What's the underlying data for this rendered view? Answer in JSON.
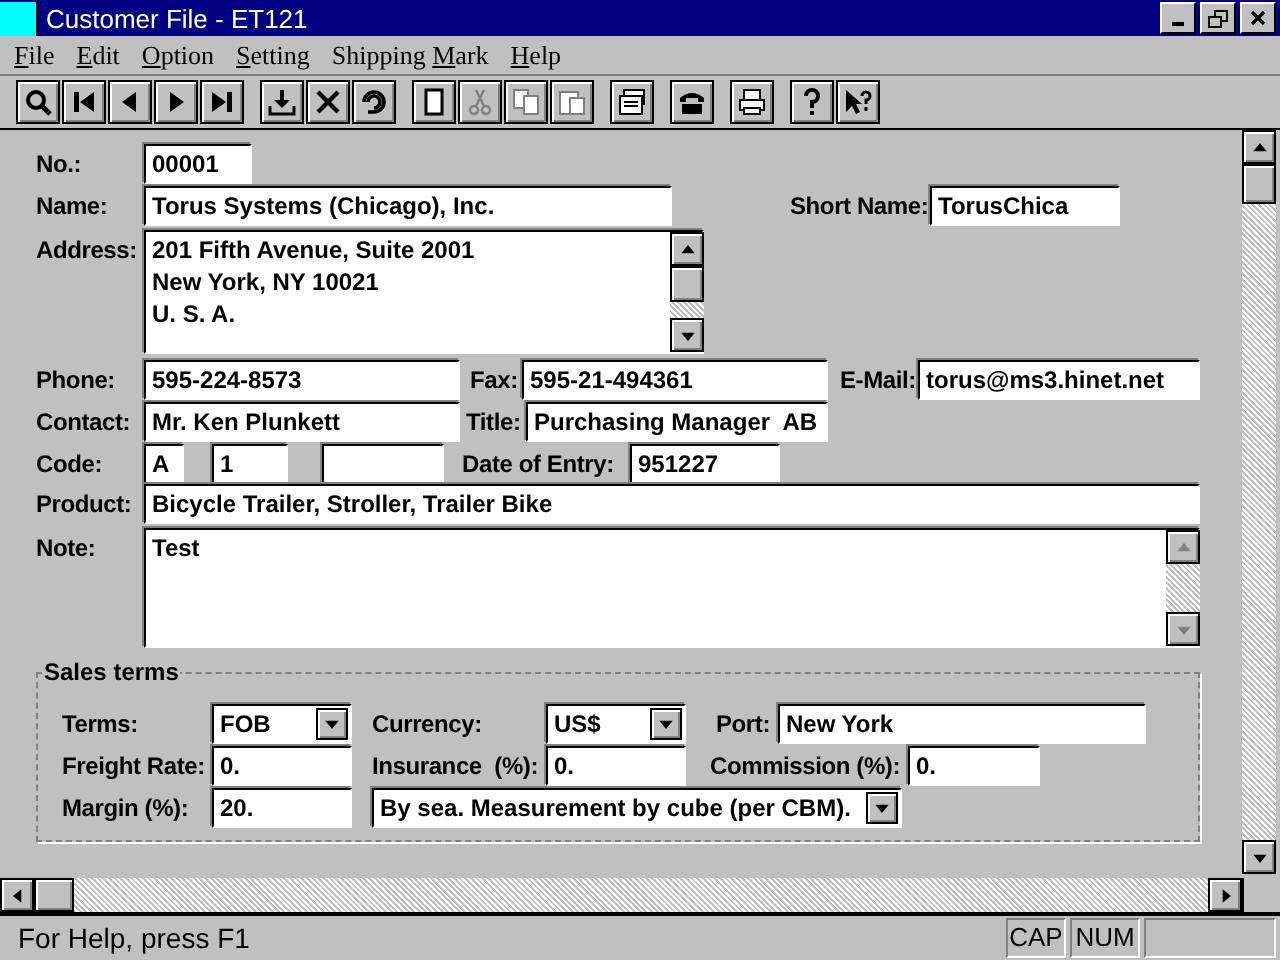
{
  "window": {
    "title": "Customer File - ET121"
  },
  "menu": [
    {
      "key": "F",
      "after": "ile"
    },
    {
      "key": "E",
      "after": "dit"
    },
    {
      "key": "O",
      "after": "ption"
    },
    {
      "key": "S",
      "after": "etting"
    },
    {
      "before": "Shipping ",
      "key": "M",
      "after": "ark"
    },
    {
      "key": "H",
      "after": "elp"
    }
  ],
  "toolbar": [
    [
      {
        "kind": "search",
        "disabled": false
      },
      {
        "kind": "first",
        "disabled": false
      },
      {
        "kind": "prev",
        "disabled": false
      },
      {
        "kind": "next",
        "disabled": false
      },
      {
        "kind": "last",
        "disabled": false
      }
    ],
    [
      {
        "kind": "save",
        "disabled": false
      },
      {
        "kind": "delete",
        "disabled": false
      },
      {
        "kind": "undo",
        "disabled": false
      }
    ],
    [
      {
        "kind": "new",
        "disabled": false
      },
      {
        "kind": "cut",
        "disabled": true
      },
      {
        "kind": "copy",
        "disabled": true
      },
      {
        "kind": "paste",
        "disabled": true
      }
    ],
    [
      {
        "kind": "cardfile",
        "disabled": false
      }
    ],
    [
      {
        "kind": "phone",
        "disabled": false
      }
    ],
    [
      {
        "kind": "print",
        "disabled": false
      }
    ],
    [
      {
        "kind": "help",
        "disabled": false
      },
      {
        "kind": "contexthelp",
        "disabled": false
      }
    ]
  ],
  "form": {
    "no": {
      "label": "No.:",
      "value": "00001"
    },
    "name": {
      "label": "Name:",
      "value": "Torus Systems (Chicago), Inc."
    },
    "short_name": {
      "label": "Short Name:",
      "value": "TorusChica"
    },
    "address": {
      "label": "Address:",
      "lines": [
        "201 Fifth Avenue, Suite 2001",
        "New York, NY 10021",
        "U. S. A."
      ]
    },
    "phone": {
      "label": "Phone:",
      "value": "595-224-8573"
    },
    "fax": {
      "label": "Fax:",
      "value": "595-21-494361"
    },
    "email": {
      "label": "E-Mail:",
      "value": "torus@ms3.hinet.net"
    },
    "contact": {
      "label": "Contact:",
      "value": "Mr. Ken Plunkett"
    },
    "title": {
      "label": "Title:",
      "value": "Purchasing Manager  AB"
    },
    "code": {
      "label": "Code:",
      "values": [
        "A",
        "1"
      ]
    },
    "date_of_entry": {
      "label": "Date of Entry:",
      "value": "951227"
    },
    "product": {
      "label": "Product:",
      "value": "Bicycle Trailer, Stroller, Trailer Bike"
    },
    "note": {
      "label": "Note:",
      "value": "Test"
    }
  },
  "sales_terms": {
    "title": "Sales terms",
    "terms": {
      "label": "Terms:",
      "value": "FOB"
    },
    "currency": {
      "label": "Currency:",
      "value": "US$"
    },
    "port": {
      "label": "Port:",
      "value": "New York"
    },
    "freight_rate": {
      "label": "Freight Rate:",
      "value": "0."
    },
    "insurance": {
      "label": "Insurance  (%):",
      "value": "0."
    },
    "commission": {
      "label": "Commission (%):",
      "value": "0."
    },
    "margin": {
      "label": "Margin (%):",
      "value": "20."
    },
    "shipping_method": {
      "value": "By sea. Measurement by cube (per CBM)."
    }
  },
  "status_bar": {
    "message": "For Help, press F1",
    "indicators": [
      "CAP",
      "NUM"
    ]
  }
}
